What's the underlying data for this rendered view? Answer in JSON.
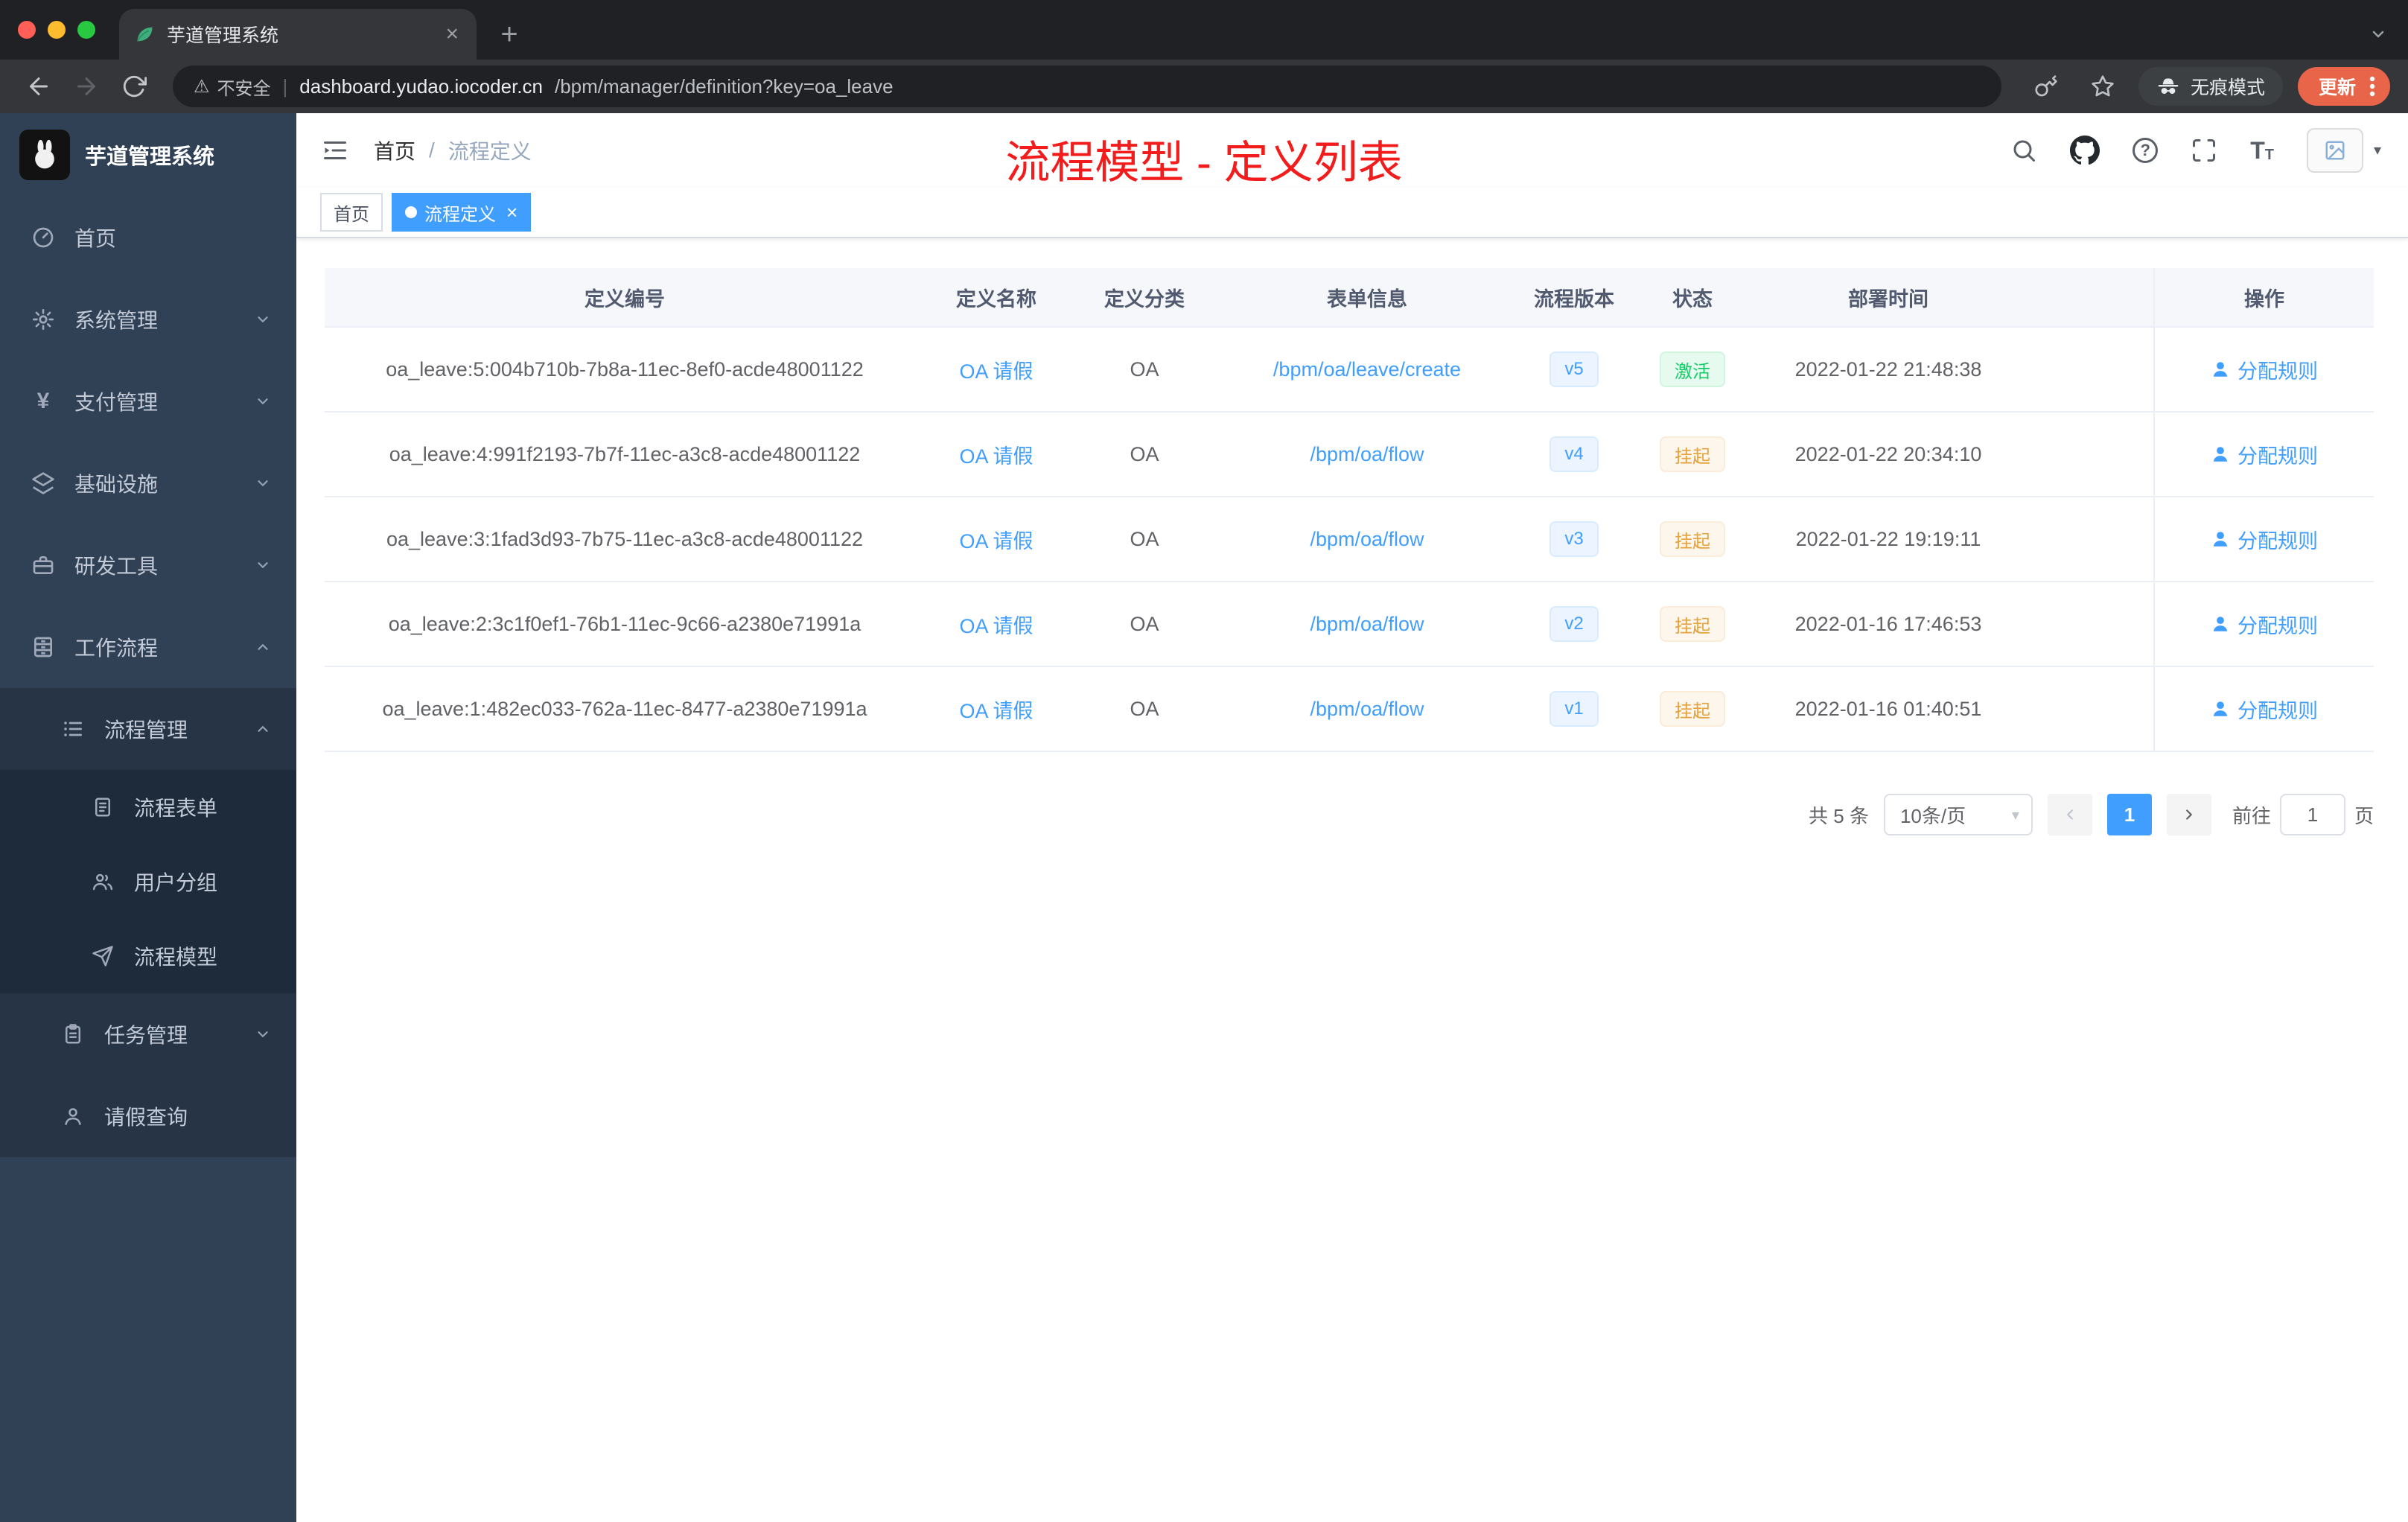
{
  "colors": {
    "accent": "#409eff",
    "success": "#13ce66",
    "warning": "#e6a23c",
    "annotation_red": "#f21c1c",
    "sidebar_bg": "#304156",
    "sidebar_submenu_bg": "#1d2b3a",
    "chrome_dark": "#202124",
    "chrome_toolbar": "#35363a",
    "update_button": "#e8654a"
  },
  "glyphs": {
    "plus": "+",
    "close": "×",
    "yen": "¥",
    "warning": "⚠",
    "help": "?",
    "caret": "▾",
    "big_t": "T",
    "small_t": "T"
  },
  "browser": {
    "tab_title": "芋道管理系统",
    "security_label": "不安全",
    "url_host": "dashboard.yudao.iocoder.cn",
    "url_path": "/bpm/manager/definition?key=oa_leave",
    "incognito_label": "无痕模式",
    "update_label": "更新"
  },
  "sidebar": {
    "app_title": "芋道管理系统",
    "menu": [
      {
        "label": "首页"
      },
      {
        "label": "系统管理"
      },
      {
        "label": "支付管理"
      },
      {
        "label": "基础设施"
      },
      {
        "label": "研发工具"
      },
      {
        "label": "工作流程"
      }
    ],
    "submenu": {
      "process": {
        "label": "流程管理"
      },
      "children": [
        {
          "label": "流程表单"
        },
        {
          "label": "用户分组"
        },
        {
          "label": "流程模型"
        }
      ],
      "task": {
        "label": "任务管理"
      },
      "leave": {
        "label": "请假查询"
      }
    }
  },
  "navbar": {
    "breadcrumb": {
      "home": "首页",
      "separator": "/",
      "current": "流程定义"
    }
  },
  "annotation": {
    "text": "流程模型 - 定义列表"
  },
  "tags_bar": {
    "home": "首页",
    "active": "流程定义"
  },
  "table": {
    "columns": {
      "id": "定义编号",
      "name": "定义名称",
      "category": "定义分类",
      "form": "表单信息",
      "version": "流程版本",
      "status": "状态",
      "deploy_time": "部署时间",
      "action": "操作"
    },
    "rows": [
      {
        "id": "oa_leave:5:004b710b-7b8a-11ec-8ef0-acde48001122",
        "name": "OA 请假",
        "category": "OA",
        "form": "/bpm/oa/leave/create",
        "version": "v5",
        "status": "激活",
        "deploy_time": "2022-01-22 21:48:38",
        "action": "分配规则"
      },
      {
        "id": "oa_leave:4:991f2193-7b7f-11ec-a3c8-acde48001122",
        "name": "OA 请假",
        "category": "OA",
        "form": "/bpm/oa/flow",
        "version": "v4",
        "status": "挂起",
        "deploy_time": "2022-01-22 20:34:10",
        "action": "分配规则"
      },
      {
        "id": "oa_leave:3:1fad3d93-7b75-11ec-a3c8-acde48001122",
        "name": "OA 请假",
        "category": "OA",
        "form": "/bpm/oa/flow",
        "version": "v3",
        "status": "挂起",
        "deploy_time": "2022-01-22 19:19:11",
        "action": "分配规则"
      },
      {
        "id": "oa_leave:2:3c1f0ef1-76b1-11ec-9c66-a2380e71991a",
        "name": "OA 请假",
        "category": "OA",
        "form": "/bpm/oa/flow",
        "version": "v2",
        "status": "挂起",
        "deploy_time": "2022-01-16 17:46:53",
        "action": "分配规则"
      },
      {
        "id": "oa_leave:1:482ec033-762a-11ec-8477-a2380e71991a",
        "name": "OA 请假",
        "category": "OA",
        "form": "/bpm/oa/flow",
        "version": "v1",
        "status": "挂起",
        "deploy_time": "2022-01-16 01:40:51",
        "action": "分配规则"
      }
    ]
  },
  "pagination": {
    "total": "共 5 条",
    "page_size": "10条/页",
    "current_page": "1",
    "goto_label": "前往",
    "goto_value": "1",
    "goto_unit": "页"
  }
}
